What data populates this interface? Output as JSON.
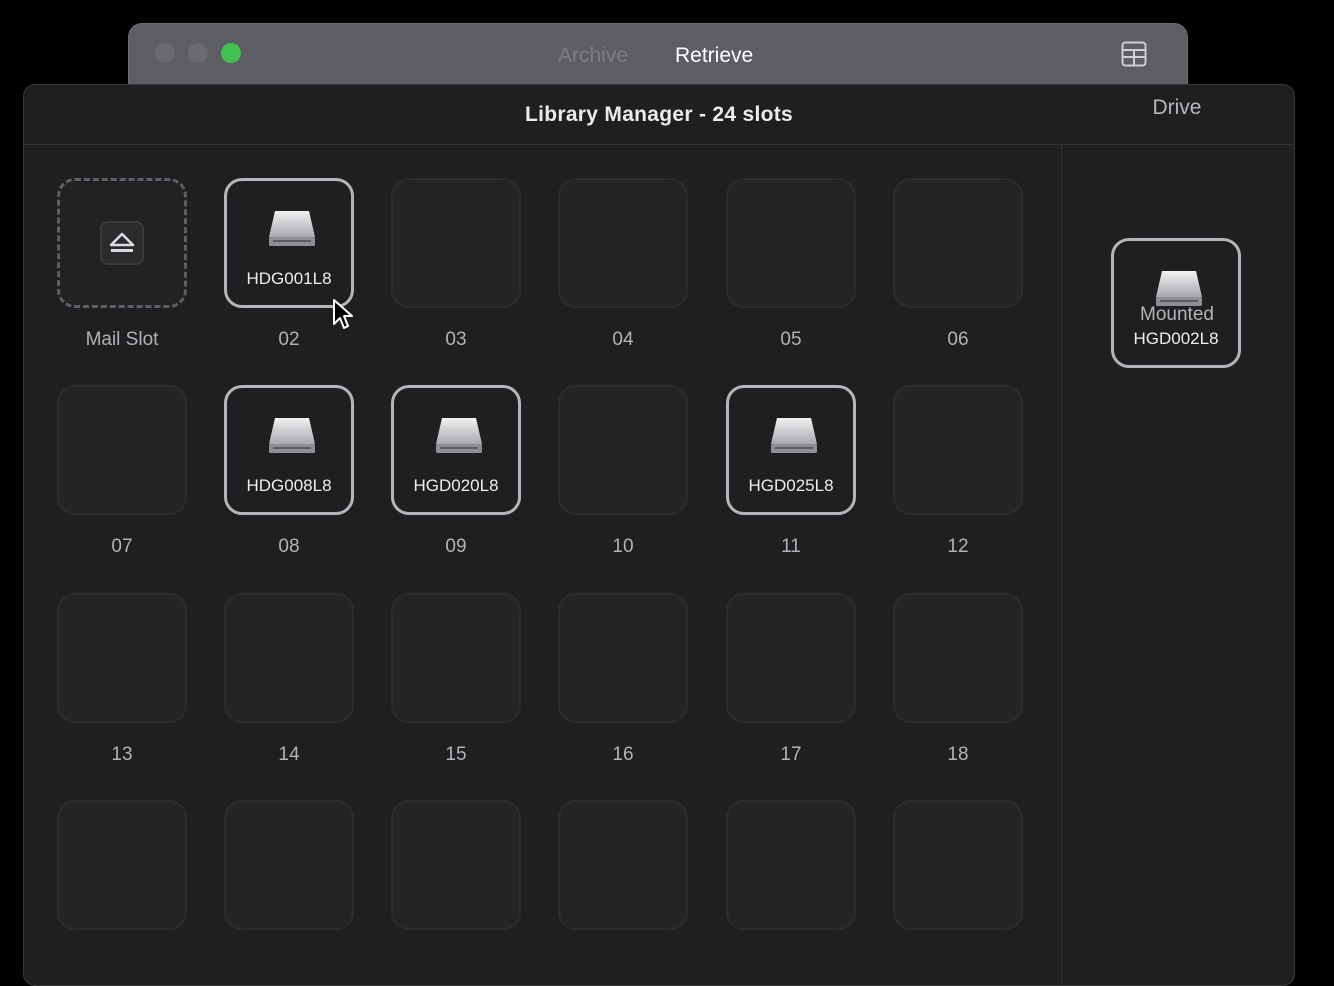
{
  "back_window": {
    "tabs": [
      {
        "label": "Archive",
        "active": false
      },
      {
        "label": "Retrieve",
        "active": true
      }
    ]
  },
  "window": {
    "title": "Library Manager - 24 slots"
  },
  "slots": [
    {
      "label": "Mail Slot",
      "type": "mail",
      "cartridge": ""
    },
    {
      "label": "02",
      "type": "filled",
      "cartridge": "HDG001L8"
    },
    {
      "label": "03",
      "type": "empty",
      "cartridge": ""
    },
    {
      "label": "04",
      "type": "empty",
      "cartridge": ""
    },
    {
      "label": "05",
      "type": "empty",
      "cartridge": ""
    },
    {
      "label": "06",
      "type": "empty",
      "cartridge": ""
    },
    {
      "label": "07",
      "type": "empty",
      "cartridge": ""
    },
    {
      "label": "08",
      "type": "filled",
      "cartridge": "HDG008L8"
    },
    {
      "label": "09",
      "type": "filled",
      "cartridge": "HGD020L8"
    },
    {
      "label": "10",
      "type": "empty",
      "cartridge": ""
    },
    {
      "label": "11",
      "type": "filled",
      "cartridge": "HGD025L8"
    },
    {
      "label": "12",
      "type": "empty",
      "cartridge": ""
    },
    {
      "label": "13",
      "type": "empty",
      "cartridge": ""
    },
    {
      "label": "14",
      "type": "empty",
      "cartridge": ""
    },
    {
      "label": "15",
      "type": "empty",
      "cartridge": ""
    },
    {
      "label": "16",
      "type": "empty",
      "cartridge": ""
    },
    {
      "label": "17",
      "type": "empty",
      "cartridge": ""
    },
    {
      "label": "18",
      "type": "empty",
      "cartridge": ""
    },
    {
      "label": "",
      "type": "empty",
      "cartridge": ""
    },
    {
      "label": "",
      "type": "empty",
      "cartridge": ""
    },
    {
      "label": "",
      "type": "empty",
      "cartridge": ""
    },
    {
      "label": "",
      "type": "empty",
      "cartridge": ""
    },
    {
      "label": "",
      "type": "empty",
      "cartridge": ""
    },
    {
      "label": "",
      "type": "empty",
      "cartridge": ""
    }
  ],
  "drive": {
    "heading": "Drive",
    "cartridge": "HGD002L8",
    "status": "Mounted"
  },
  "colors": {
    "green_light": "#3fc24f",
    "background": "#1f1f21",
    "filled_border": "#b5b5b9"
  },
  "icons": {
    "mail_slot": "eject-icon",
    "cartridge": "hard-drive-icon",
    "layout": "layout-grid-icon"
  }
}
